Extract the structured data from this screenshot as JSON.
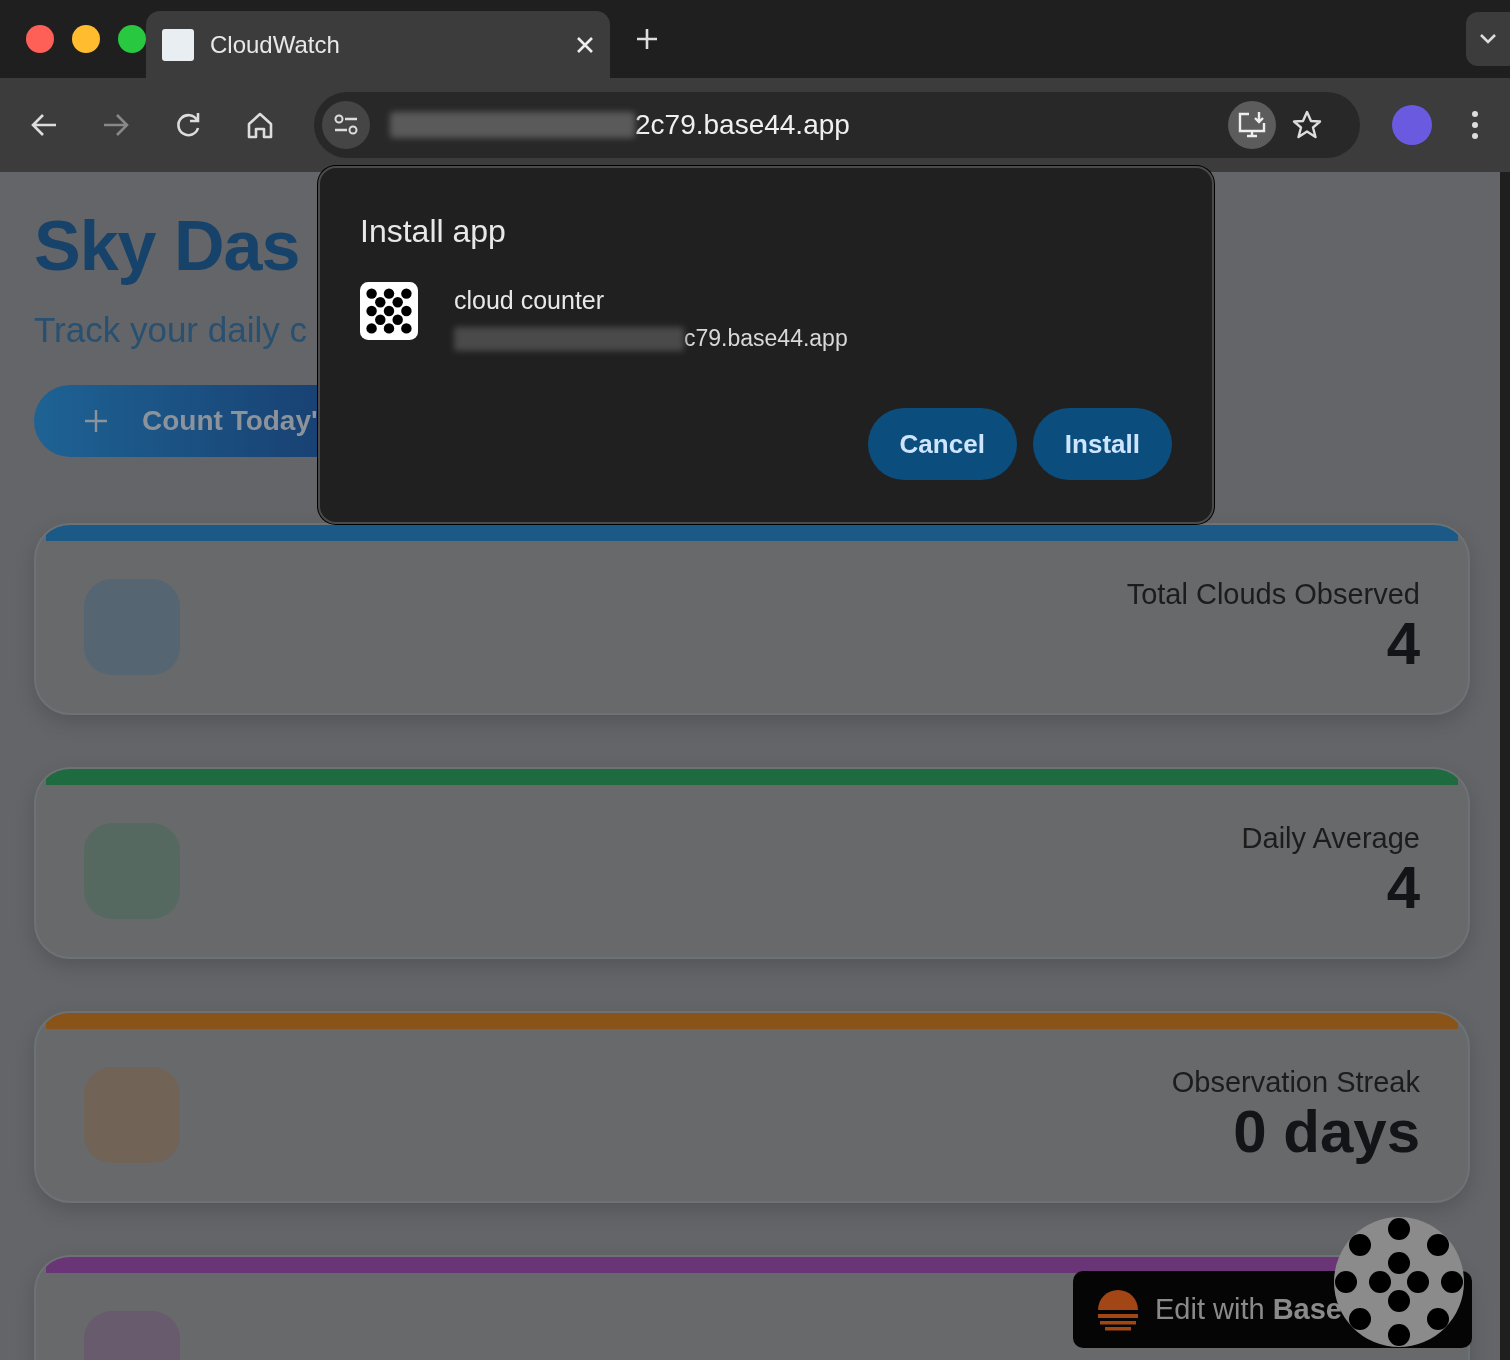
{
  "browser": {
    "tab_title": "CloudWatch",
    "address_visible": "2c79.base44.app"
  },
  "page": {
    "title": "Sky Das",
    "subtitle": "Track your daily c",
    "count_button": "Count Today'",
    "stats": [
      {
        "label": "Total Clouds Observed",
        "value": "4",
        "color": "#1b5a86"
      },
      {
        "label": "Daily Average",
        "value": "4",
        "color": "#1e6b40"
      },
      {
        "label": "Observation Streak",
        "value": "0 days",
        "color": "#8a5418"
      },
      {
        "color": "#6a3577"
      }
    ]
  },
  "dialog": {
    "title": "Install app",
    "app_name": "cloud counter",
    "app_url": "c79.base44.app",
    "buttons": [
      "Cancel",
      "Install"
    ]
  },
  "badge": {
    "text": "Edit with **Base**"
  }
}
